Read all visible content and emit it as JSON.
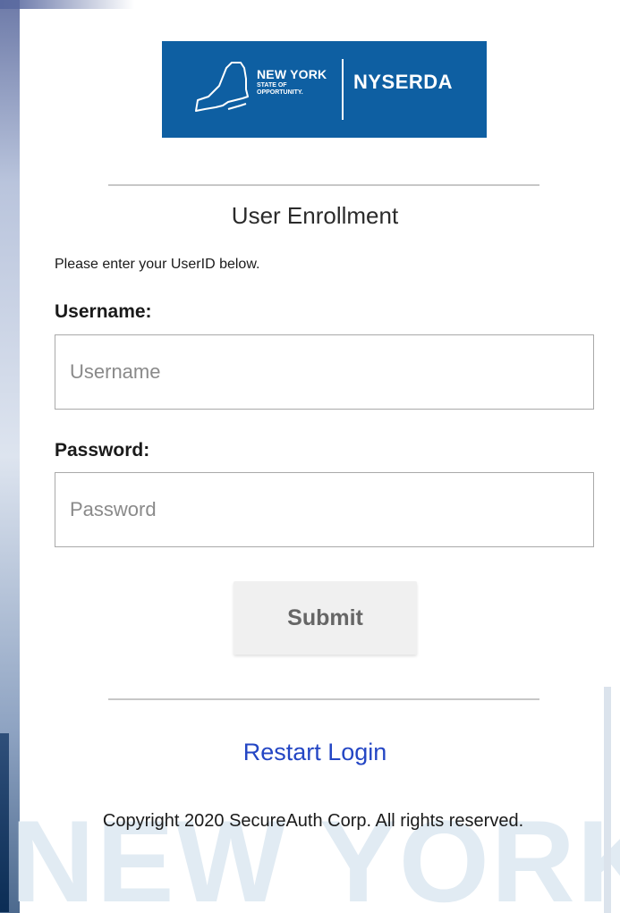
{
  "logo": {
    "state_name": "NEW YORK",
    "state_line1": "STATE OF",
    "state_line2": "OPPORTUNITY.",
    "org": "NYSERDA",
    "brand_color": "#0e5fa2"
  },
  "form": {
    "title": "User Enrollment",
    "instruction": "Please enter your UserID below.",
    "username_label": "Username:",
    "username_placeholder": "Username",
    "username_value": "",
    "password_label": "Password:",
    "password_placeholder": "Password",
    "password_value": "",
    "submit_label": "Submit"
  },
  "footer": {
    "restart_label": "Restart Login",
    "copyright": "Copyright 2020 SecureAuth Corp. All rights reserved.",
    "link_color": "#2446c4"
  },
  "background": {
    "watermark": "NEW YORK"
  }
}
